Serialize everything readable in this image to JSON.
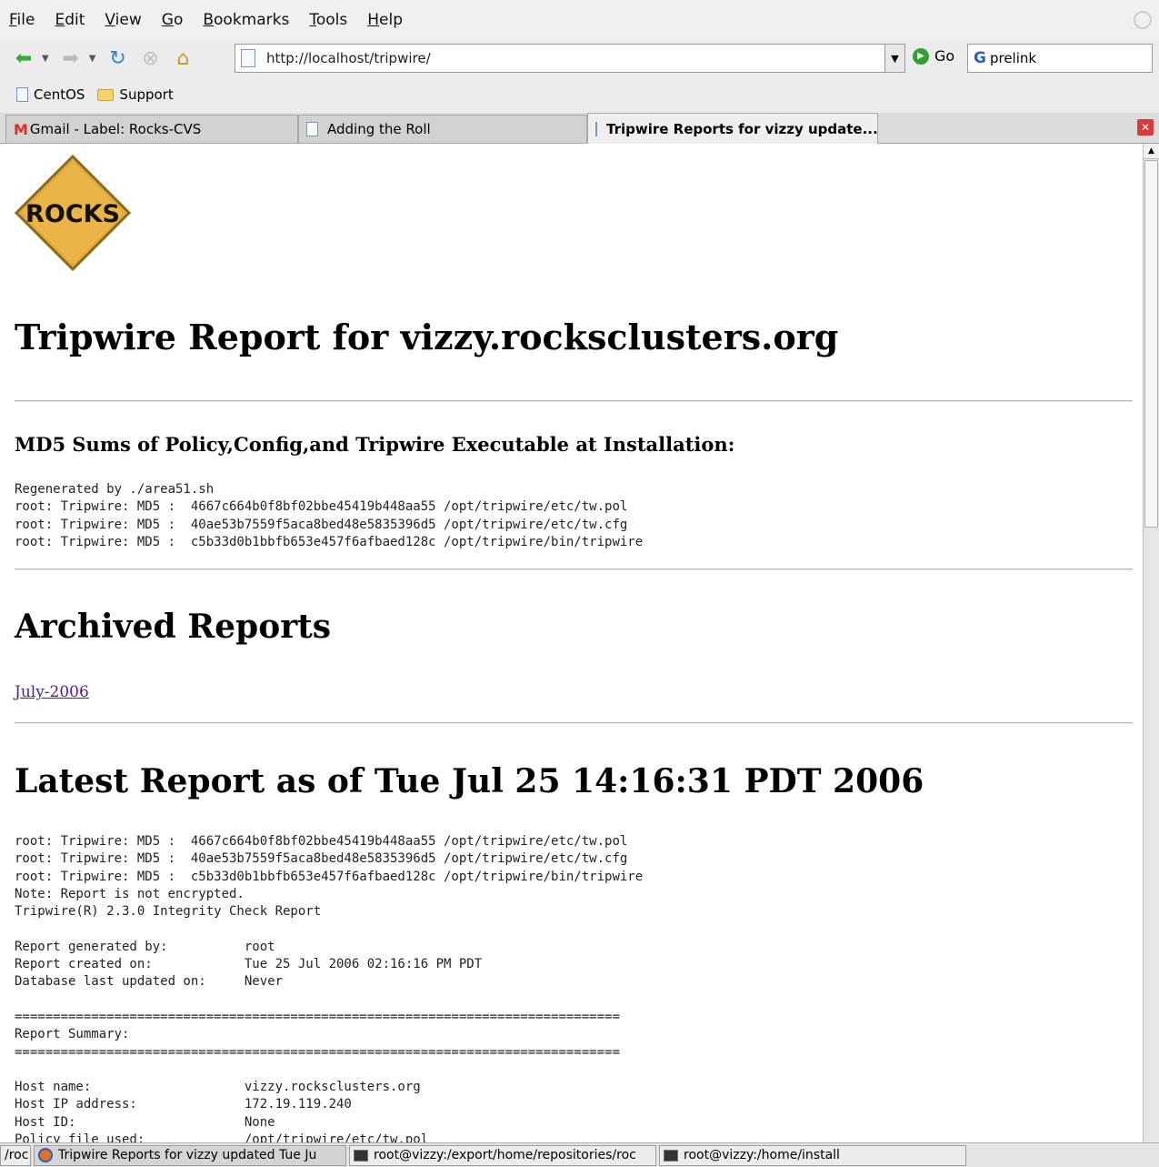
{
  "menubar": {
    "items": [
      "File",
      "Edit",
      "View",
      "Go",
      "Bookmarks",
      "Tools",
      "Help"
    ]
  },
  "navbar": {
    "url": "http://localhost/tripwire/",
    "go_label": "Go",
    "search_value": "prelink"
  },
  "bookmarks": [
    "CentOS",
    "Support"
  ],
  "tabs": [
    {
      "label": "Gmail - Label: Rocks-CVS",
      "active": false
    },
    {
      "label": "Adding the Roll",
      "active": false
    },
    {
      "label": "Tripwire Reports for vizzy update...",
      "active": true
    }
  ],
  "page": {
    "logo_text": "ROCKS",
    "title": "Tripwire Report for vizzy.rocksclusters.org",
    "md5_heading": "MD5 Sums of Policy,Config,and Tripwire Executable at Installation:",
    "md5_block": "Regenerated by ./area51.sh\nroot: Tripwire: MD5 :  4667c664b0f8bf02bbe45419b448aa55 /opt/tripwire/etc/tw.pol\nroot: Tripwire: MD5 :  40ae53b7559f5aca8bed48e5835396d5 /opt/tripwire/etc/tw.cfg\nroot: Tripwire: MD5 :  c5b33d0b1bbfb653e457f6afbaed128c /opt/tripwire/bin/tripwire",
    "archived_heading": "Archived Reports",
    "archive_link": "July-2006",
    "latest_heading": "Latest Report as of Tue Jul 25 14:16:31 PDT 2006",
    "latest_block": "root: Tripwire: MD5 :  4667c664b0f8bf02bbe45419b448aa55 /opt/tripwire/etc/tw.pol\nroot: Tripwire: MD5 :  40ae53b7559f5aca8bed48e5835396d5 /opt/tripwire/etc/tw.cfg\nroot: Tripwire: MD5 :  c5b33d0b1bbfb653e457f6afbaed128c /opt/tripwire/bin/tripwire\nNote: Report is not encrypted.\nTripwire(R) 2.3.0 Integrity Check Report\n\nReport generated by:          root\nReport created on:            Tue 25 Jul 2006 02:16:16 PM PDT\nDatabase last updated on:     Never\n\n===============================================================================\nReport Summary:\n===============================================================================\n\nHost name:                    vizzy.rocksclusters.org\nHost IP address:              172.19.119.240\nHost ID:                      None\nPolicy file used:             /opt/tripwire/etc/tw.pol"
  },
  "taskbar": [
    {
      "label": "/roc",
      "icon": "none"
    },
    {
      "label": "Tripwire Reports for vizzy updated Tue Ju",
      "icon": "firefox-icon"
    },
    {
      "label": "root@vizzy:/export/home/repositories/roc",
      "icon": "terminal-icon"
    },
    {
      "label": "root@vizzy:/home/install",
      "icon": "terminal-icon"
    }
  ]
}
